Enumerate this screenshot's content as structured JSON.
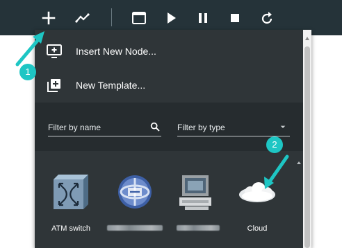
{
  "menu": {
    "insert_node": "Insert New Node...",
    "new_template": "New Template..."
  },
  "filters": {
    "name_label": "Filter by name",
    "type_label": "Filter by type"
  },
  "nodes": [
    {
      "label": "ATM switch",
      "icon": "atm-switch-icon"
    },
    {
      "label": "",
      "icon": "router-globe-icon",
      "label_blurred": true
    },
    {
      "label": "",
      "icon": "computer-icon",
      "label_blurred": true
    },
    {
      "label": "Cloud",
      "icon": "cloud-icon"
    }
  ],
  "annotations": [
    {
      "number": "1"
    },
    {
      "number": "2"
    }
  ],
  "colors": {
    "toolbar": "#253339",
    "panel": "#2f3538",
    "accent": "#1ec6c4"
  },
  "toolbar_icons": [
    "add-icon",
    "link-icon",
    "console-window-icon",
    "play-icon",
    "pause-icon",
    "stop-icon",
    "reload-icon"
  ]
}
